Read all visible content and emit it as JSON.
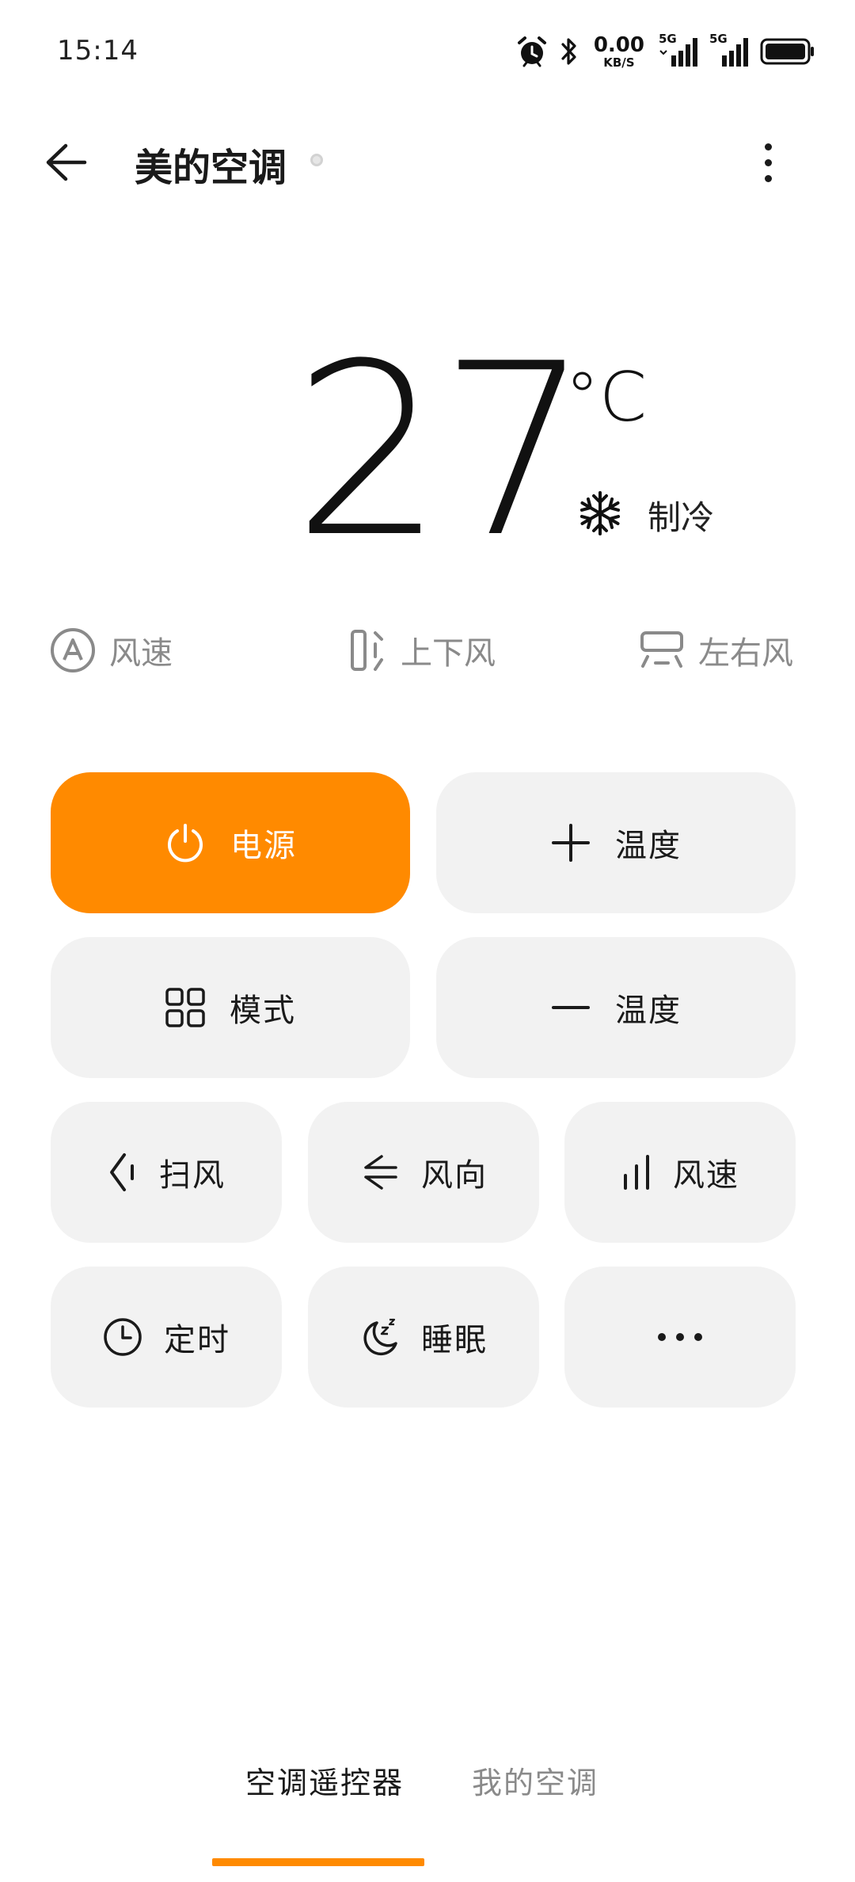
{
  "status_bar": {
    "time": "15:14",
    "net_speed_value": "0.00",
    "net_speed_unit": "KB/S",
    "signal_1_label": "5G",
    "signal_2_label": "5G",
    "icons": [
      "alarm-icon",
      "bluetooth-icon",
      "signal-icon",
      "signal-icon",
      "battery-icon"
    ]
  },
  "header": {
    "title": "美的空调",
    "back_icon": "arrow-left-icon",
    "more_icon": "more-vertical-icon"
  },
  "display": {
    "temperature": "27",
    "unit": "°C",
    "mode_icon": "snowflake-icon",
    "mode_label": "制冷"
  },
  "quick_status": [
    {
      "icon": "auto-circle-icon",
      "label": "风速"
    },
    {
      "icon": "vertical-swing-icon",
      "label": "上下风"
    },
    {
      "icon": "horizontal-swing-icon",
      "label": "左右风"
    }
  ],
  "controls": {
    "power": {
      "icon": "power-icon",
      "label": "电源"
    },
    "temp_up": {
      "icon": "plus-icon",
      "label": "温度"
    },
    "mode": {
      "icon": "grid-icon",
      "label": "模式"
    },
    "temp_down": {
      "icon": "minus-icon",
      "label": "温度"
    },
    "swing": {
      "icon": "swing-icon",
      "label": "扫风"
    },
    "direction": {
      "icon": "wind-direction-icon",
      "label": "风向"
    },
    "fan_speed": {
      "icon": "bars-icon",
      "label": "风速"
    },
    "timer": {
      "icon": "clock-icon",
      "label": "定时"
    },
    "sleep": {
      "icon": "moon-zz-icon",
      "label": "睡眠"
    },
    "more": {
      "icon": "more-horizontal-icon"
    }
  },
  "tabs": [
    {
      "label": "空调遥控器",
      "active": true
    },
    {
      "label": "我的空调",
      "active": false
    }
  ],
  "colors": {
    "accent": "#ff8a00",
    "button_bg": "#f2f2f2",
    "muted_text": "#8a8a8a"
  }
}
